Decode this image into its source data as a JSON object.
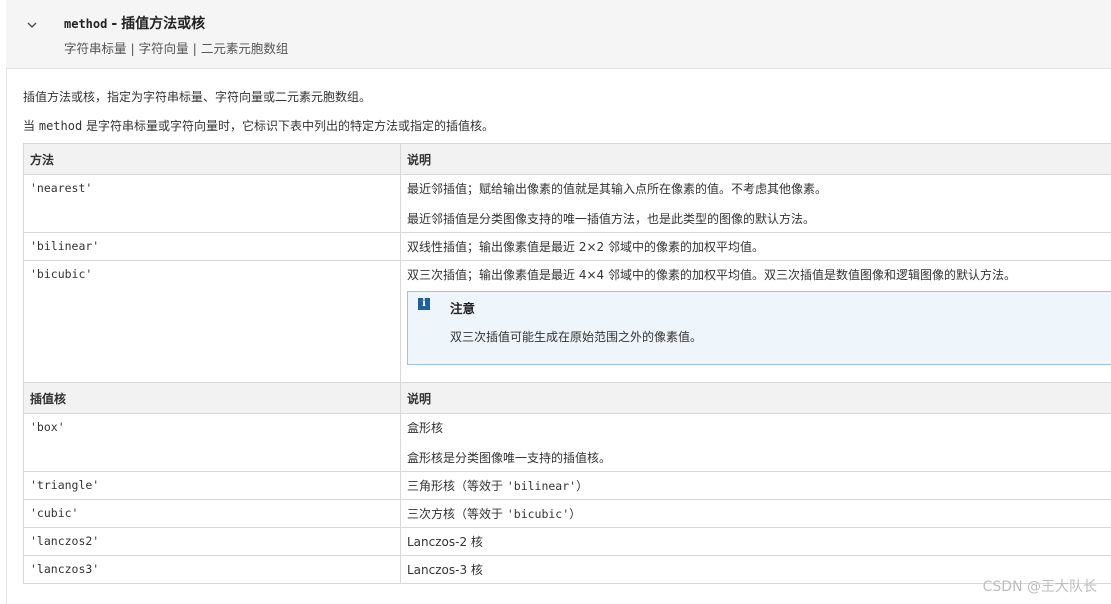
{
  "header": {
    "param_name": "method",
    "separator": "-",
    "title": "插值方法或核",
    "subtitle": "字符串标量 | 字符向量 | 二元素元胞数组",
    "toggle_icon": "chevron-down-icon"
  },
  "intro": {
    "line1": "插值方法或核，指定为字符串标量、字符向量或二元素元胞数组。",
    "line2_prefix": "当",
    "line2_code": "method",
    "line2_suffix": "是字符串标量或字符向量时，它标识下表中列出的特定方法或指定的插值核。"
  },
  "methods_table": {
    "headers": [
      "方法",
      "说明"
    ],
    "rows": [
      {
        "key": "'nearest'",
        "lines": [
          "最近邻插值；赋给输出像素的值就是其输入点所在像素的值。不考虑其他像素。",
          "最近邻插值是分类图像支持的唯一插值方法，也是此类型的图像的默认方法。"
        ]
      },
      {
        "key": "'bilinear'",
        "lines": [
          "双线性插值；输出像素值是最近 2×2 邻域中的像素的加权平均值。"
        ]
      },
      {
        "key": "'bicubic'",
        "lines": [
          "双三次插值；输出像素值是最近 4×4 邻域中的像素的加权平均值。双三次插值是数值图像和逻辑图像的默认方法。"
        ],
        "note": {
          "icon": "info-icon",
          "title": "注意",
          "text": "双三次插值可能生成在原始范围之外的像素值。"
        }
      }
    ]
  },
  "kernels_table": {
    "headers": [
      "插值核",
      "说明"
    ],
    "rows": [
      {
        "key": "'box'",
        "lines": [
          "盒形核",
          "盒形核是分类图像唯一支持的插值核。"
        ]
      },
      {
        "key": "'triangle'",
        "text_prefix": "三角形核（等效于",
        "text_code": "'bilinear'",
        "text_suffix": "）"
      },
      {
        "key": "'cubic'",
        "text_prefix": "三次方核（等效于",
        "text_code": "'bicubic'",
        "text_suffix": "）"
      },
      {
        "key": "'lanczos2'",
        "lines": [
          "Lanczos-2 核"
        ]
      },
      {
        "key": "'lanczos3'",
        "lines": [
          "Lanczos-3 核"
        ]
      }
    ]
  },
  "watermark": "CSDN @王大队长"
}
